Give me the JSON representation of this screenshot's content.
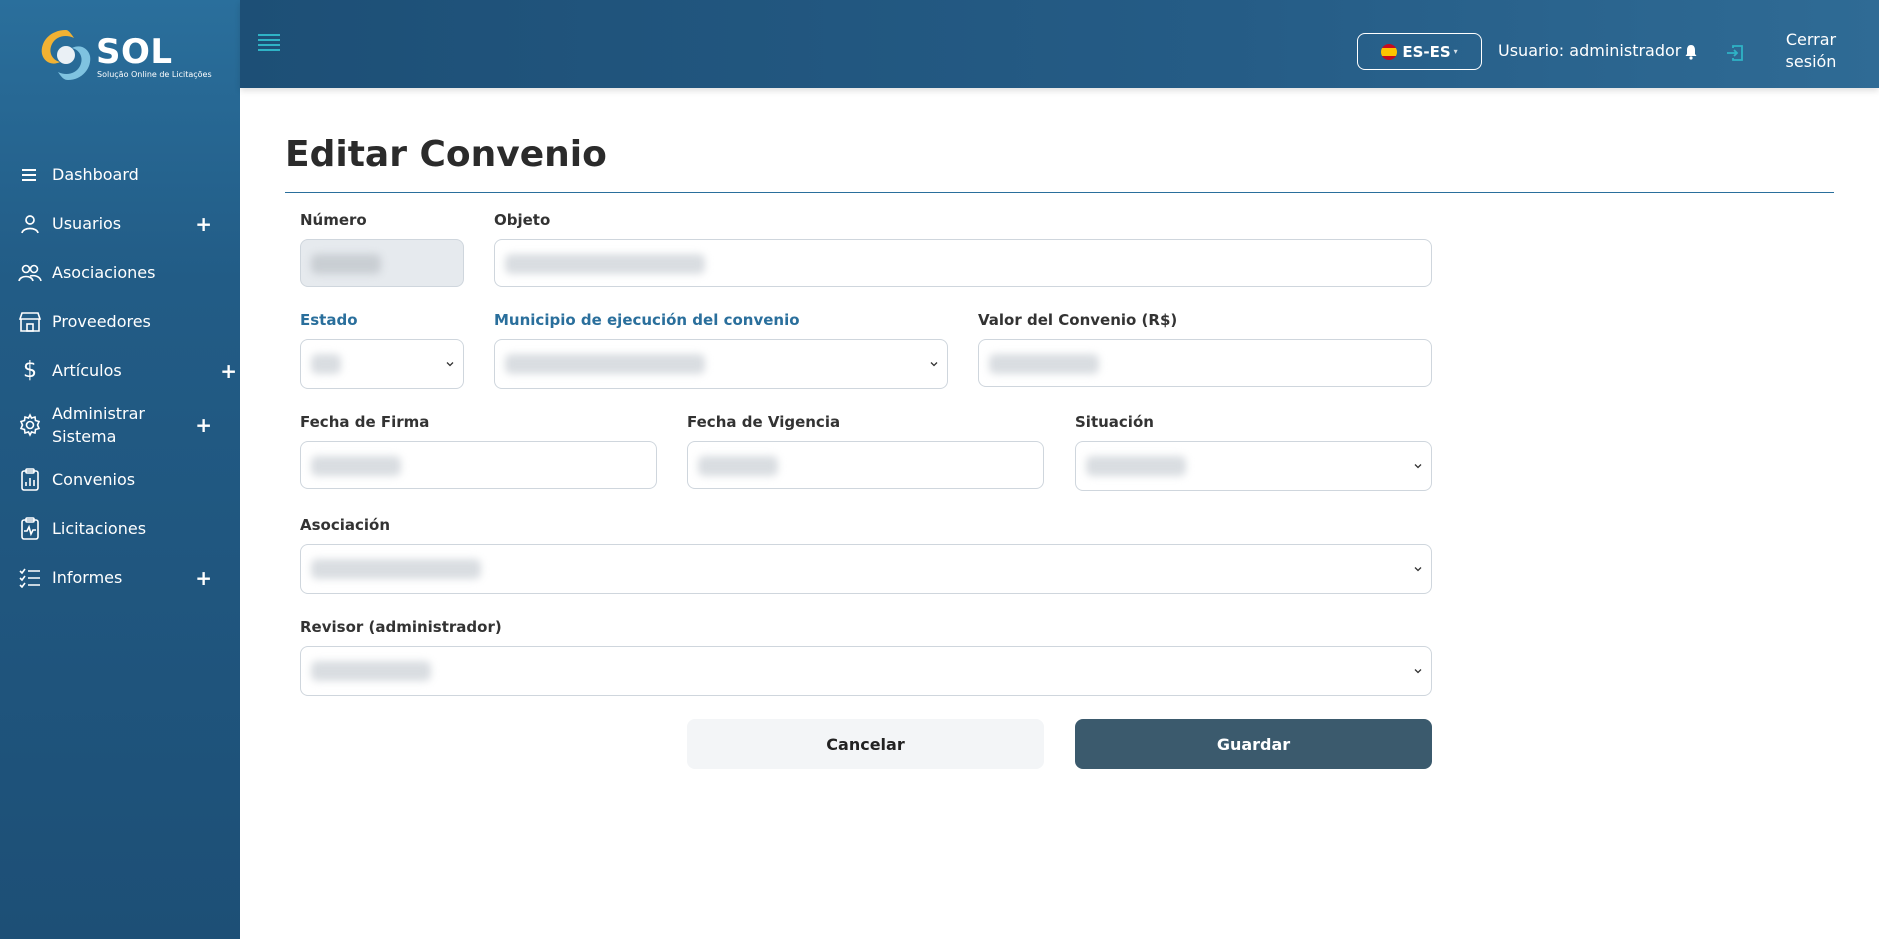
{
  "brand": {
    "name": "SOL",
    "tagline": "Solução Online de Licitações"
  },
  "sidebar": {
    "items": [
      {
        "label": "Dashboard",
        "icon": "menu-icon",
        "expandable": false
      },
      {
        "label": "Usuarios",
        "icon": "user-icon",
        "expandable": true
      },
      {
        "label": "Asociaciones",
        "icon": "users-icon",
        "expandable": false
      },
      {
        "label": "Proveedores",
        "icon": "store-icon",
        "expandable": false
      },
      {
        "label": "Artículos",
        "icon": "dollar-icon",
        "expandable": true
      },
      {
        "label": "Administrar Sistema",
        "icon": "gear-icon",
        "expandable": true
      },
      {
        "label": "Convenios",
        "icon": "clipboard-chart-icon",
        "expandable": false
      },
      {
        "label": "Licitaciones",
        "icon": "clipboard-pulse-icon",
        "expandable": false
      },
      {
        "label": "Informes",
        "icon": "list-check-icon",
        "expandable": true
      }
    ],
    "plus_glyph": "+"
  },
  "header": {
    "language": "ES-ES",
    "user": "Usuario: administrador",
    "logout": "Cerrar sesión"
  },
  "form": {
    "title": "Editar Convenio",
    "fields": {
      "numero": {
        "label": "Número"
      },
      "objeto": {
        "label": "Objeto"
      },
      "estado": {
        "label": "Estado"
      },
      "municipio": {
        "label": "Municipio de ejecución del convenio"
      },
      "valor": {
        "label": "Valor del Convenio (R$)"
      },
      "fecha_firma": {
        "label": "Fecha de Firma"
      },
      "fecha_vigencia": {
        "label": "Fecha de Vigencia"
      },
      "situacion": {
        "label": "Situación"
      },
      "asociacion": {
        "label": "Asociación"
      },
      "revisor": {
        "label": "Revisor (administrador)"
      }
    },
    "buttons": {
      "cancel": "Cancelar",
      "save": "Guardar"
    }
  },
  "colors": {
    "sidebar": "#225c86",
    "header": "#1d4f76",
    "accent": "#2a6f9c",
    "save_button": "#3b5a6d"
  }
}
